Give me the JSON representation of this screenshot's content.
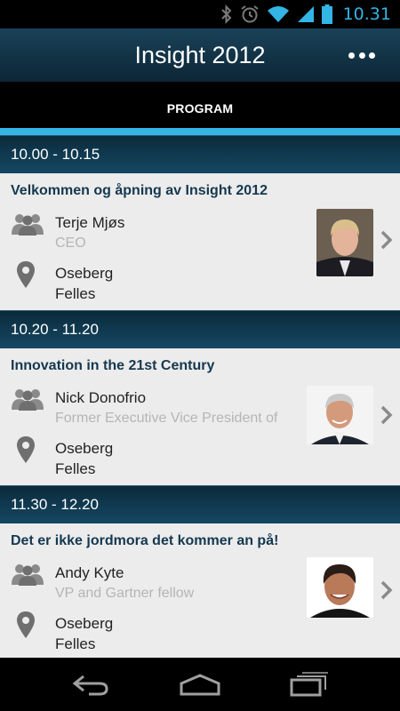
{
  "status_bar": {
    "time": "10.31",
    "icons": [
      "bluetooth-icon",
      "alarm-icon",
      "wifi-icon",
      "signal-icon",
      "battery-icon"
    ]
  },
  "app_bar": {
    "title": "Insight 2012",
    "overflow_icon": "overflow-menu-icon"
  },
  "tabs": [
    {
      "label": "PROGRAM",
      "selected": true
    }
  ],
  "sessions": [
    {
      "time": "10.00 - 10.15",
      "title": "Velkommen og åpning av Insight 2012",
      "speaker": "Terje Mjøs",
      "role": "CEO",
      "room": "Oseberg",
      "track": "Felles"
    },
    {
      "time": "10.20 - 11.20",
      "title": "Innovation in the 21st Century",
      "speaker": "Nick Donofrio",
      "role": "Former Executive Vice President of",
      "room": "Oseberg",
      "track": "Felles"
    },
    {
      "time": "11.30 - 12.20",
      "title": "Det er ikke jordmora det kommer an på!",
      "speaker": "Andy Kyte",
      "role": "VP and Gartner fellow",
      "room": "Oseberg",
      "track": "Felles"
    }
  ],
  "nav_bar": {
    "icons": [
      "back-icon",
      "home-icon",
      "recent-apps-icon"
    ]
  },
  "colors": {
    "accent": "#33b5e5",
    "header_dark": "#0b2a3b",
    "list_bg": "#ececec",
    "title_text": "#15384f"
  }
}
